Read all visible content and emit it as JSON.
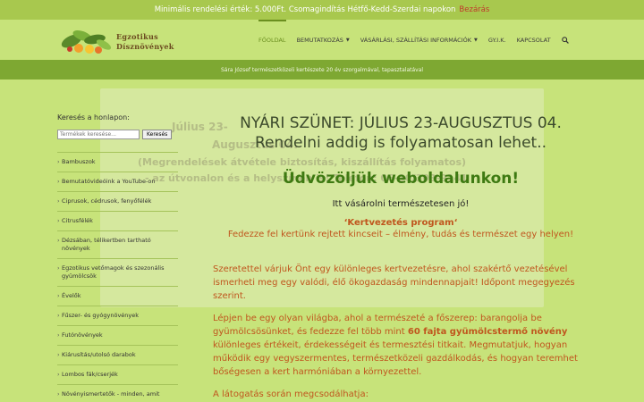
{
  "notice": {
    "text": "Minimális rendelési érték: 5.000Ft. Csomagindítás Hétfő-Kedd-Szerdai napokon",
    "close_label": "Bezárás"
  },
  "logo": {
    "line1": "Egzotikus",
    "line2": "Dísznövények"
  },
  "nav": {
    "items": [
      {
        "label": "Főoldal",
        "active": true,
        "dropdown": false
      },
      {
        "label": "Bemutatkozás",
        "active": false,
        "dropdown": true
      },
      {
        "label": "Vásárlási, szállítási információk",
        "active": false,
        "dropdown": true
      },
      {
        "label": "GY.I.K.",
        "active": false,
        "dropdown": false
      },
      {
        "label": "Kapcsolat",
        "active": false,
        "dropdown": false
      }
    ],
    "search_icon": "search-icon"
  },
  "subbar": {
    "text": "Sára József természetközeli kertészete 20 év szorgalmával, tapasztalatával"
  },
  "sidebar": {
    "search_heading": "Keresés a honlapon:",
    "search_placeholder": "Termékek keresése...",
    "search_button": "Keresés",
    "categories": [
      "Bambuszok",
      "Bemutatóvideóink a YouTube-on",
      "Ciprusok, cédrusok, fenyőfélék",
      "Citrusfélék",
      "Dézsában, télikertben tartható növények",
      "Egzotikus vetőmagok és szezonális gyümölcsök",
      "Évelők",
      "Fűszer- és gyógynövények",
      "Futónövények",
      "Kiárusítás/utolsó darabok",
      "Lombos fák/cserjék",
      "Növényismertetők - minden, amit"
    ]
  },
  "content": {
    "summer_line1": "NYÁRI SZÜNET: JÚLIUS 23-AUGUSZTUS 04.",
    "summer_line2": "Rendelni addig is folyamatosan lehet..",
    "welcome": "Üdvözöljük weboldalunkon!",
    "buy": "Itt vásárolni természetesen jó!",
    "program": "‘Kertvezetés program‘",
    "fedezze": "Fedezze fel kertünk rejtett kincseit – élmény, tudás és természet egy helyen!",
    "para1": "Szeretettel várjuk Önt egy különleges kertvezetésre, ahol szakértő vezetésével ismerheti meg egy valódi, élő ökogazdaság mindennapjait! Időpont megegyezés szerint.",
    "para2_before": "Lépjen be egy olyan világba, ahol a természeté a főszerep: barangolja be gyümölcsösünket, és fedezze fel több mint ",
    "para2_bold": "60 fajta gyümölcstermő növény",
    "para2_after": " különleges értékeit, érdekességeit és termesztési titkait. Megmutatjuk, hogyan működik egy vegyszermentes, természetközeli gazdálkodás, és hogyan teremhet bőségesen a kert harmóniában a környezettel.",
    "para3": "A látogatás során megcsodálhatja:"
  },
  "ghost": {
    "line1": "Július 23-",
    "line2": "Augusztus 04.",
    "line3": "(Megrendelések átvétele biztosítás, kiszállítás folyamatos)",
    "line4": "- az útvonalon és a helyszínen is! Telefon: 06-30/303-9141"
  },
  "colors": {
    "notice_bg": "#a8c84e",
    "header_bg": "#c7e37a",
    "subbar_bg": "#7ea832",
    "accent_green": "#3e7a12",
    "accent_orange": "#c0561e",
    "close_red": "#c0392b"
  }
}
